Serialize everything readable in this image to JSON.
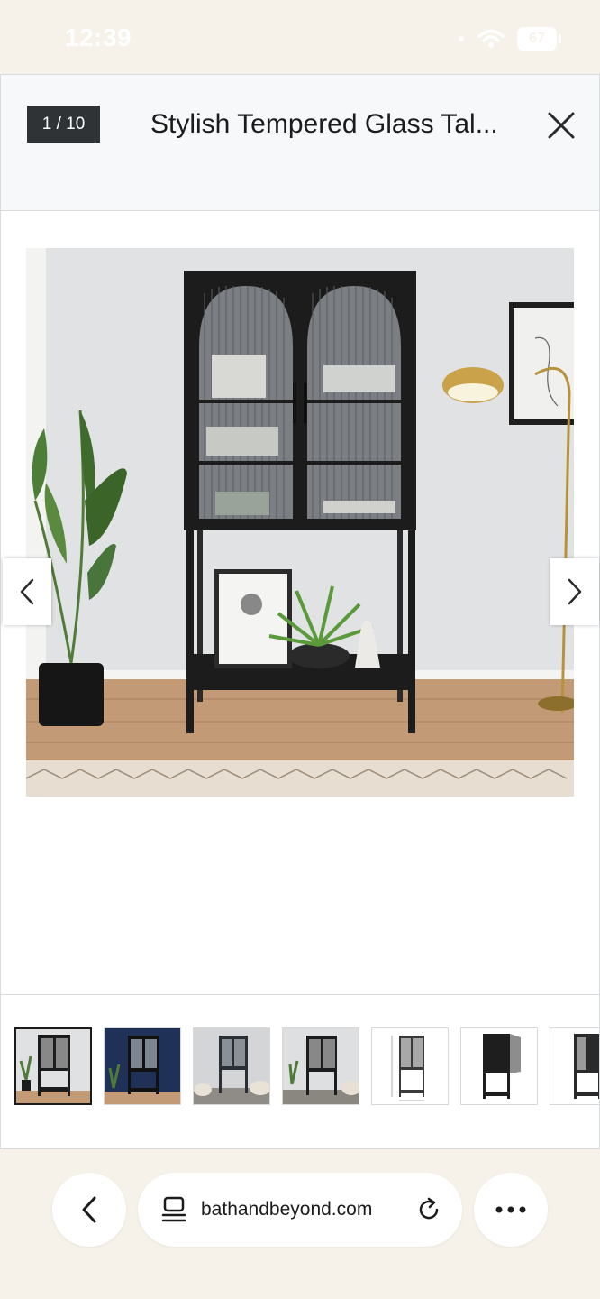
{
  "status": {
    "time": "12:39",
    "battery": "67"
  },
  "gallery": {
    "counter": "1 / 10",
    "title": "Stylish Tempered Glass Tal...",
    "thumbnails": [
      "thumb-1",
      "thumb-2",
      "thumb-3",
      "thumb-4",
      "thumb-5",
      "thumb-6",
      "thumb-7"
    ]
  },
  "browser": {
    "url": "bathandbeyond.com"
  },
  "icons": {
    "close": "close-icon",
    "prev": "chevron-left-icon",
    "next": "chevron-right-icon",
    "back": "back-icon",
    "tabs": "tabs-icon",
    "reload": "reload-icon",
    "more": "more-icon"
  },
  "colors": {
    "counter_bg": "#2f3336",
    "page_bg": "#f6f2ea",
    "header_bg": "#f7f8fa"
  }
}
